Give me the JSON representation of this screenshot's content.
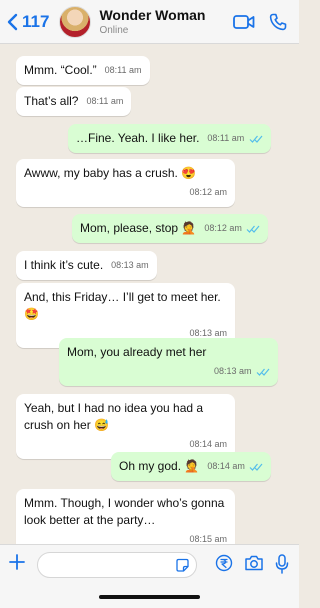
{
  "header": {
    "back_count": "117",
    "contact_name": "Wonder Woman",
    "contact_status": "Online",
    "accent_color": "#1a73e8"
  },
  "messages": [
    {
      "dir": "in",
      "text": "Mmm. “Cool.”",
      "time": "08:11 am"
    },
    {
      "dir": "in",
      "text": "That’s all?",
      "time": "08:11 am"
    },
    {
      "dir": "out",
      "text": "…Fine. Yeah. I like her.",
      "time": "08:11 am",
      "read": true
    },
    {
      "dir": "in",
      "text": "Awww, my baby has a crush. 😍",
      "time": "08:12 am"
    },
    {
      "dir": "out",
      "text": "Mom, please, stop 🤦",
      "time": "08:12 am",
      "read": true
    },
    {
      "dir": "in",
      "text": "I think it’s cute.",
      "time": "08:13 am"
    },
    {
      "dir": "in",
      "text": "And, this Friday… I’ll get to meet her. 🤩",
      "time": "08:13 am"
    },
    {
      "dir": "out",
      "text": "Mom, you already met her",
      "time": "08:13 am",
      "read": true
    },
    {
      "dir": "in",
      "text": "Yeah, but I had no idea you had a crush on her 😅",
      "time": "08:14 am"
    },
    {
      "dir": "out",
      "text": "Oh my god. 🤦",
      "time": "08:14 am",
      "read": true
    },
    {
      "dir": "in",
      "text": "Mmm. Though, I wonder who’s gonna look better at the party…",
      "time": "08:15 am"
    }
  ],
  "icons": {
    "back": "chevron-left-icon",
    "video": "video-call-icon",
    "phone": "phone-call-icon",
    "attach": "plus-icon",
    "sticker": "sticker-icon",
    "payment": "rupee-payment-icon",
    "camera": "camera-icon",
    "mic": "microphone-icon",
    "read_receipt": "double-check-icon"
  },
  "colors": {
    "incoming_bubble": "#ffffff",
    "outgoing_bubble": "#d9fdd3",
    "read_tick": "#53bdeb",
    "chat_background": "#efeae2"
  }
}
